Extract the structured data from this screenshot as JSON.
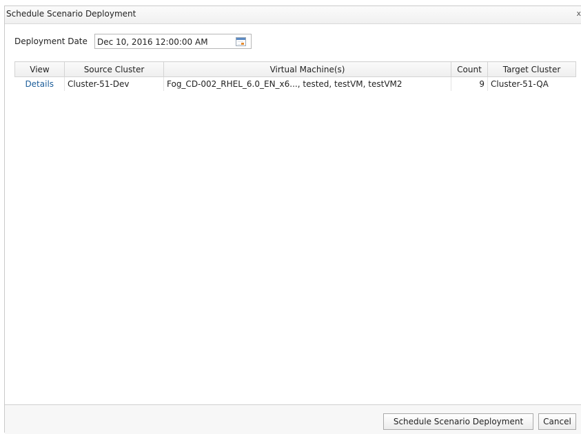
{
  "dialog": {
    "title": "Schedule Scenario Deployment",
    "close_label": "x"
  },
  "deployment": {
    "label": "Deployment Date",
    "value": "Dec 10, 2016 12:00:00 AM",
    "calendar_icon": "calendar-icon"
  },
  "table": {
    "columns": [
      "View",
      "Source Cluster",
      "Virtual Machine(s)",
      "Count",
      "Target Cluster"
    ],
    "rows": [
      {
        "view": "Details",
        "source_cluster": "Cluster-51-Dev",
        "virtual_machines": "Fog_CD-002_RHEL_6.0_EN_x6..., tested, testVM, testVM2",
        "count": "9",
        "target_cluster": "Cluster-51-QA"
      }
    ]
  },
  "footer": {
    "schedule_button": "Schedule Scenario Deployment",
    "cancel_button": "Cancel"
  }
}
